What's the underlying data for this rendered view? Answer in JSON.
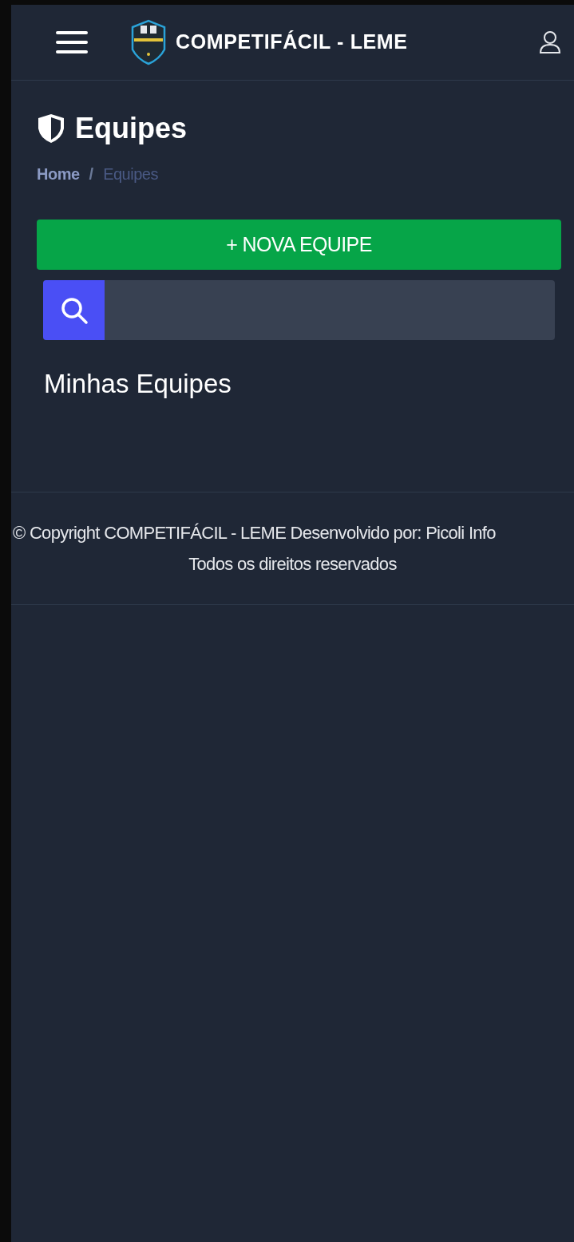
{
  "header": {
    "brand": "COMPETIFÁCIL - LEME"
  },
  "page": {
    "title": "Equipes",
    "breadcrumb_separator": "/",
    "breadcrumb": [
      {
        "label": "Home",
        "selected": false
      },
      {
        "label": "Equipes",
        "selected": true
      }
    ],
    "add_button": {
      "label": "+ NOVA EQUIPE"
    },
    "section_title": "Minhas Equipes"
  },
  "footer": {
    "lines": [
      "© Copyright COMPETIFÁCIL - LEME Desenvolvido por: Picoli Info",
      "Todos os direitos reservados"
    ]
  }
}
